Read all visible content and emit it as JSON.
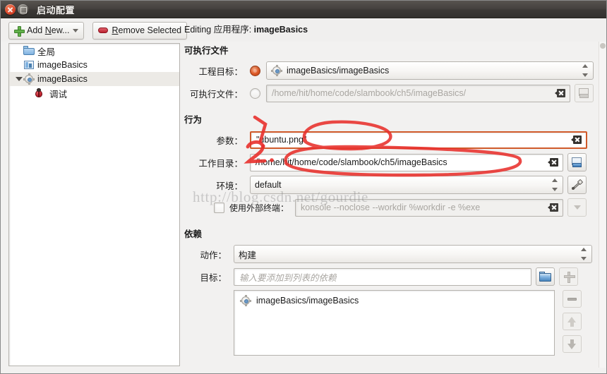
{
  "window": {
    "title": "启动配置",
    "close_icon": "close-icon",
    "minimize_icon": "minimize-icon"
  },
  "toolbar": {
    "add_new_label_pre": "Add ",
    "add_new_mnemonic": "N",
    "add_new_label_post": "ew...",
    "add_new_full": "Add New...",
    "remove_selected_mnemonic": "R",
    "remove_selected_post": "emove Selected",
    "remove_selected_full": "Remove Selected",
    "add_icon": "plus-icon",
    "remove_icon": "minus-icon",
    "dropdown_icon": "chevron-down-icon"
  },
  "sidebar": {
    "items": [
      {
        "label": "全局",
        "icon": "folder-icon",
        "indent": 0,
        "selected": false,
        "twisty": "none"
      },
      {
        "label": "imageBasics",
        "icon": "project-icon",
        "indent": 0,
        "selected": false,
        "twisty": "none"
      },
      {
        "label": "imageBasics",
        "icon": "gear-icon",
        "indent": 1,
        "selected": true,
        "twisty": "open"
      },
      {
        "label": "调试",
        "icon": "bug-icon",
        "indent": 2,
        "selected": false,
        "twisty": "none"
      }
    ]
  },
  "main": {
    "editing_prefix": "Editing 应用程序: ",
    "editing_target": "imageBasics",
    "sections": {
      "executable": {
        "title": "可执行文件",
        "project_target": {
          "label": "工程目标：",
          "radio_selected": true,
          "value": "imageBasics/imageBasics",
          "icon": "gear-icon"
        },
        "executable_path": {
          "label": "可执行文件：",
          "radio_selected": false,
          "value": "/home/hit/home/code/slambook/ch5/imageBasics/",
          "disabled": true,
          "clear_icon": "clear-icon",
          "browse_icon": "browse-icon"
        }
      },
      "behavior": {
        "title": "行为",
        "arguments": {
          "label": "参数：",
          "value": "\"ubuntu.png\"",
          "clear_icon": "clear-icon",
          "highlighted": true
        },
        "working_directory": {
          "label": "工作目录：",
          "value": "/home/hit/home/code/slambook/ch5/imageBasics",
          "clear_icon": "clear-icon",
          "browse_icon": "browse-icon",
          "highlighted": true
        },
        "environment": {
          "label": "环境：",
          "value": "default",
          "tool_icon": "wrench-icon"
        },
        "external_terminal": {
          "label": "使用外部终端：",
          "checked": false,
          "value": "konsole --noclose --workdir %workdir -e %exe",
          "disabled": true,
          "clear_icon": "clear-icon",
          "dropdown_icon": "chevron-down-icon"
        }
      },
      "dependencies": {
        "title": "依赖",
        "action": {
          "label": "动作：",
          "value": "构建"
        },
        "target": {
          "label": "目标：",
          "value": "",
          "placeholder": "输入要添加到列表的依赖",
          "folder_icon": "folder-icon",
          "add_icon": "plus-icon"
        },
        "list_items": [
          {
            "label": "imageBasics/imageBasics",
            "icon": "gear-icon"
          }
        ],
        "side_buttons": [
          {
            "name": "remove-dependency-button",
            "icon": "minus-icon"
          },
          {
            "name": "move-up-button",
            "icon": "arrow-up-icon"
          },
          {
            "name": "move-down-button",
            "icon": "arrow-down-icon"
          }
        ]
      }
    }
  },
  "annotations": {
    "marker_color": "#e8302c",
    "items": [
      {
        "label": "1.",
        "target": "arguments-field"
      },
      {
        "label": "2.",
        "target": "working-directory-field"
      }
    ]
  },
  "watermark": {
    "text": "http://blog.csdn.net/gourdie"
  }
}
